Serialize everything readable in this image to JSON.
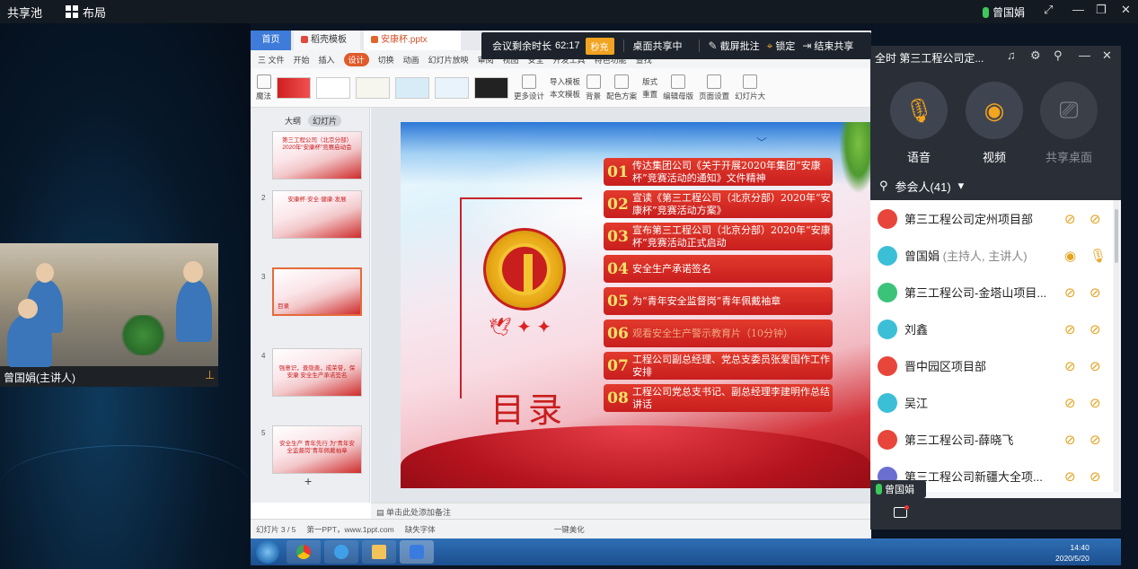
{
  "topbar": {
    "shared_pool": "共享池",
    "layout": "布局",
    "host_name": "曾国娟"
  },
  "video": {
    "speaker_label": "曾国娟(主讲人)"
  },
  "wps": {
    "tabs": [
      {
        "label": "首页"
      },
      {
        "label": "稻壳模板"
      },
      {
        "label": "安康杯.pptx"
      }
    ],
    "menu": [
      {
        "label": "三 文件"
      },
      {
        "label": "开始"
      },
      {
        "label": "插入"
      },
      {
        "label": "设计"
      },
      {
        "label": "切换"
      },
      {
        "label": "动画"
      },
      {
        "label": "幻灯片放映"
      },
      {
        "label": "审阅"
      },
      {
        "label": "视图"
      },
      {
        "label": "安全"
      },
      {
        "label": "开发工具"
      },
      {
        "label": "特色功能"
      },
      {
        "label": "查找"
      }
    ],
    "ribbon": {
      "magic": "魔法",
      "more_design": "更多设计",
      "import_template": "导入模板",
      "text_template": "本文模板",
      "background": "背景",
      "color_scheme": "配色方案",
      "layout": "版式",
      "reset": "重置",
      "edit_master": "编辑母版",
      "page_setup": "页面设置",
      "slide_size": "幻灯片大"
    },
    "thumb_tabs": {
      "outline": "大纲",
      "slides": "幻灯片"
    },
    "thumbnails": [
      {
        "num": "",
        "title": "第三工程公司（北京分部）2020年“安康杯”竞赛启动会"
      },
      {
        "num": "2",
        "title": "安康杯·安全·健康·发展"
      },
      {
        "num": "3",
        "title": "目录"
      },
      {
        "num": "4",
        "title": "强意识，查隐患，成荣誉，保安康 安全生产承诺签名"
      },
      {
        "num": "5",
        "title": "安全生产 青年先行 为“青年安全监督岗”青年佩戴袖章"
      }
    ],
    "add_slide": "+",
    "notes_placeholder": "单击此处添加备注",
    "status": {
      "slide_pos": "幻灯片 3 / 5",
      "theme": "第一PPT，www.1ppt.com",
      "missing_font": "缺失字体",
      "beautify": "一键美化"
    }
  },
  "meeting_bar": {
    "remaining_label": "会议剩余时长",
    "remaining_time": "62:17",
    "renew": "秒充",
    "desktop_sharing": "桌面共享中",
    "annotate": "截屏批注",
    "lock": "锁定",
    "end_share": "结束共享"
  },
  "slide": {
    "title": "目录",
    "agenda": [
      {
        "num": "01",
        "text": "传达集团公司《关于开展2020年集团“安康杯”竞赛活动的通知》文件精神"
      },
      {
        "num": "02",
        "text": "宣读《第三工程公司（北京分部）2020年“安康杯”竞赛活动方案》"
      },
      {
        "num": "03",
        "text": "宣布第三工程公司（北京分部）2020年“安康杯”竞赛活动正式启动"
      },
      {
        "num": "04",
        "text": "安全生产承诺签名"
      },
      {
        "num": "05",
        "text": "为“青年安全监督岗”青年佩戴袖章"
      },
      {
        "num": "06",
        "text": "观看安全生产警示教育片（10分钟）"
      },
      {
        "num": "07",
        "text": "工程公司副总经理、党总支委员张爱国作工作安排"
      },
      {
        "num": "08",
        "text": "工程公司党总支书记、副总经理李建明作总结讲话"
      }
    ]
  },
  "panel": {
    "title": "全时 第三工程公司定...",
    "voice": "语音",
    "video": "视频",
    "share_desktop": "共享桌面",
    "participants_label": "参会人(41)",
    "members": [
      {
        "name": "第三工程公司定州项目部",
        "role": "",
        "color": "#e8463b"
      },
      {
        "name": "曾国娟",
        "role": "(主持人, 主讲人)",
        "color": "#3bbfd7"
      },
      {
        "name": "第三工程公司-金塔山项目...",
        "role": "",
        "color": "#3bc37a"
      },
      {
        "name": "刘鑫",
        "role": "",
        "color": "#3bbfd7"
      },
      {
        "name": "晋中园区项目部",
        "role": "",
        "color": "#e8463b"
      },
      {
        "name": "吴江",
        "role": "",
        "color": "#3bbfd7"
      },
      {
        "name": "第三工程公司-薛晓飞",
        "role": "",
        "color": "#e8463b"
      },
      {
        "name": "第三工程公司新疆大全项...",
        "role": "",
        "color": "#6a6fd0"
      }
    ],
    "speaking": "曾国娟"
  },
  "taskbar": {
    "time": "14:40",
    "date": "2020/5/20"
  },
  "colors": {
    "accent_orange": "#f1a321",
    "wps_blue": "#3f7bd9",
    "slide_red": "#c81e1e"
  }
}
